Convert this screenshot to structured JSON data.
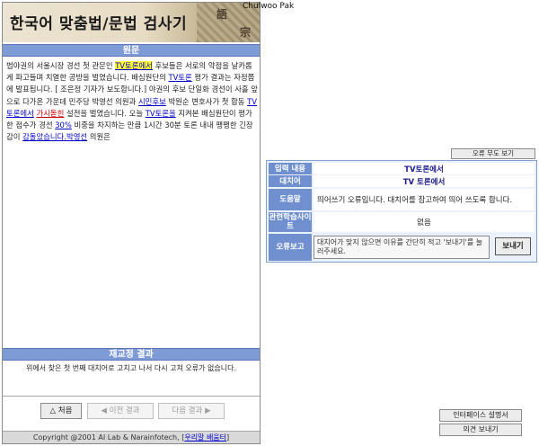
{
  "banner": {
    "title": "한국어 맞춤법/문법 검사기",
    "deco_chars": [
      "語",
      "宗"
    ]
  },
  "author": "Chulwoo Pak",
  "original": {
    "header": "원문",
    "segments": [
      {
        "t": "범야권의 서울시장 경선 첫 관문인 ",
        "k": "n"
      },
      {
        "t": "TV토론에서",
        "k": "cur"
      },
      {
        "t": " 후보들은 서로의 약점을 날카롭게 파고들며 치열한 공방을 벌였습니다. 배심원단의 ",
        "k": "n"
      },
      {
        "t": "TV토론",
        "k": "b"
      },
      {
        "t": " 평가 결과는 자정쯤에 발표됩니다. [ 조은정 기자가 보도합니다.] 야권의 후보 단일화 경선이 사흘 앞으로 다가온 가운데 민주당 박영선 의원과 ",
        "k": "n"
      },
      {
        "t": "시민후보",
        "k": "b"
      },
      {
        "t": " 박원순 변호사가 첫 합동 ",
        "k": "n"
      },
      {
        "t": "TV토론에서",
        "k": "b"
      },
      {
        "t": " ",
        "k": "n"
      },
      {
        "t": "가시돋힌",
        "k": "r"
      },
      {
        "t": " 설전을 벌였습니다. 오늘 ",
        "k": "n"
      },
      {
        "t": "TV토론을",
        "k": "b"
      },
      {
        "t": " 지켜본 배심원단이 평가한 점수가 경선 ",
        "k": "n"
      },
      {
        "t": "30%",
        "k": "b"
      },
      {
        "t": " 비중을 차지하는 만큼 1시간 30분 토론 내내 팽팽한 긴장감이 ",
        "k": "n"
      },
      {
        "t": "감돌았습니다.",
        "k": "b"
      },
      {
        "t": "박영선",
        "k": "b"
      },
      {
        "t": " 의원은",
        "k": "n"
      }
    ]
  },
  "result": {
    "header": "재교정 결과",
    "message": "위에서 찾은 첫 번째 대치어로 고치고 나서 다시 고쳐 오류가 없습니다."
  },
  "nav": {
    "first": "처음",
    "prev": "이전 결과",
    "next": "다음 결과"
  },
  "copyright": {
    "text": "Copyright @2001 AI Lab & Narainfotech, [",
    "link": "우리말 배움터",
    "end": "]"
  },
  "right": {
    "show_original": "오류 무도 보기",
    "info": {
      "input_label": "입력 내용",
      "input_value": "TV토론에서",
      "replace_label": "대치어",
      "replace_value": "TV 토론에서",
      "help_label": "도움말",
      "help_value": "띄어쓰기 오류입니다. 대치어를 참고하여 띄어 쓰도록 합니다.",
      "related_label": "관련학습사이트",
      "related_value": "없음",
      "report_label": "오류보고",
      "report_placeholder": "대치어가 맞지 않으면 이유를 간단히 적고 '보내기'를 눌러주세요.",
      "send": "보내기"
    },
    "interface_btn": "인터페이스 설명서",
    "feedback_btn": "의견 보내기"
  }
}
